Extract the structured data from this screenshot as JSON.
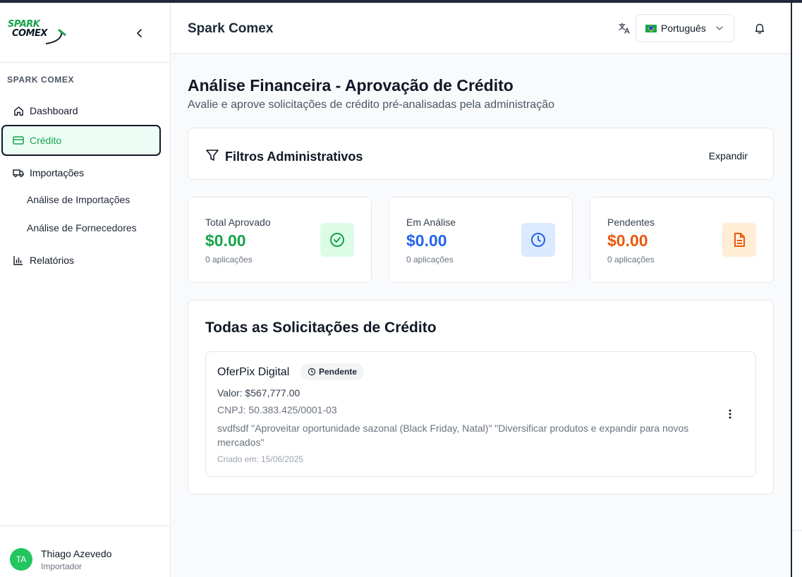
{
  "brand": {
    "logo_line1": "SPARK",
    "logo_line2": "COMEX"
  },
  "sidebar": {
    "section_label": "SPARK COMEX",
    "items": [
      {
        "label": "Dashboard",
        "icon": "home-icon"
      },
      {
        "label": "Crédito",
        "icon": "credit-card-icon",
        "active": true
      },
      {
        "label": "Importações",
        "icon": "truck-icon"
      },
      {
        "label": "Análise de Importações"
      },
      {
        "label": "Análise de Fornecedores"
      },
      {
        "label": "Relatórios",
        "icon": "bar-chart-icon"
      }
    ],
    "user": {
      "initials": "TA",
      "name": "Thiago Azevedo",
      "role": "Importador"
    }
  },
  "header": {
    "title": "Spark Comex",
    "language": "Português"
  },
  "page": {
    "title": "Análise Financeira - Aprovação de Crédito",
    "subtitle": "Avalie e aprove solicitações de crédito pré-analisadas pela administração"
  },
  "filters": {
    "title": "Filtros Administrativos",
    "expand_label": "Expandir"
  },
  "stats": [
    {
      "label": "Total Aprovado",
      "value": "$0.00",
      "count": "0 aplicações",
      "color": "#16a34a",
      "icon_bg": "#dcfce7",
      "icon": "check-circle-icon"
    },
    {
      "label": "Em Análise",
      "value": "$0.00",
      "count": "0 aplicações",
      "color": "#2563eb",
      "icon_bg": "#dbeafe",
      "icon": "clock-icon"
    },
    {
      "label": "Pendentes",
      "value": "$0.00",
      "count": "0 aplicações",
      "color": "#ea580c",
      "icon_bg": "#ffedd5",
      "icon": "document-icon"
    }
  ],
  "requests": {
    "title": "Todas as Solicitações de Crédito",
    "items": [
      {
        "company": "OferPix Digital",
        "status": "Pendente",
        "valor": "Valor: $567,777.00",
        "cnpj": "CNPJ: 50.383.425/0001-03",
        "description": "svdfsdf \"Aproveitar oportunidade sazonal (Black Friday, Natal)\" \"Diversificar produtos e expandir para novos mercados\"",
        "created": "Criado em: 15/06/2025"
      }
    ]
  }
}
